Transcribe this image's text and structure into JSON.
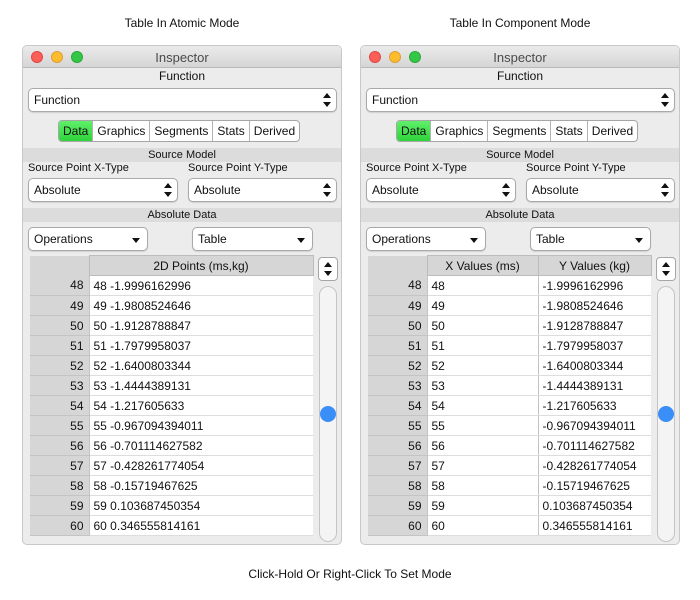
{
  "captions": {
    "left": "Table In Atomic Mode",
    "right": "Table In Component Mode",
    "bottom": "Click-Hold Or Right-Click To Set Mode"
  },
  "window": {
    "title": "Inspector",
    "function_label": "Function",
    "function_value": "Function",
    "tabs": [
      "Data",
      "Graphics",
      "Segments",
      "Stats",
      "Derived"
    ],
    "active_tab": "Data",
    "source_model_label": "Source Model",
    "x_type_label": "Source Point X-Type",
    "x_type_value": "Absolute",
    "y_type_label": "Source Point Y-Type",
    "y_type_value": "Absolute",
    "absolute_data_label": "Absolute Data",
    "operations_value": "Operations",
    "view_value": "Table",
    "scroll_level": 0.5
  },
  "atomic_table": {
    "header": "2D Points (ms,kg)",
    "rows": [
      {
        "n": "48",
        "v": "48 -1.9996162996"
      },
      {
        "n": "49",
        "v": "49 -1.9808524646"
      },
      {
        "n": "50",
        "v": "50 -1.9128788847"
      },
      {
        "n": "51",
        "v": "51 -1.7979958037"
      },
      {
        "n": "52",
        "v": "52 -1.6400803344"
      },
      {
        "n": "53",
        "v": "53 -1.4444389131"
      },
      {
        "n": "54",
        "v": "54 -1.217605633"
      },
      {
        "n": "55",
        "v": "55 -0.967094394011"
      },
      {
        "n": "56",
        "v": "56 -0.701114627582"
      },
      {
        "n": "57",
        "v": "57 -0.428261774054"
      },
      {
        "n": "58",
        "v": "58 -0.15719467625"
      },
      {
        "n": "59",
        "v": "59 0.103687450354"
      },
      {
        "n": "60",
        "v": "60 0.346555814161"
      }
    ]
  },
  "component_table": {
    "x_header": "X Values (ms)",
    "y_header": "Y Values (kg)",
    "rows": [
      {
        "n": "48",
        "x": "48",
        "y": "-1.9996162996"
      },
      {
        "n": "49",
        "x": "49",
        "y": "-1.9808524646"
      },
      {
        "n": "50",
        "x": "50",
        "y": "-1.9128788847"
      },
      {
        "n": "51",
        "x": "51",
        "y": "-1.7979958037"
      },
      {
        "n": "52",
        "x": "52",
        "y": "-1.6400803344"
      },
      {
        "n": "53",
        "x": "53",
        "y": "-1.4444389131"
      },
      {
        "n": "54",
        "x": "54",
        "y": "-1.217605633"
      },
      {
        "n": "55",
        "x": "55",
        "y": "-0.967094394011"
      },
      {
        "n": "56",
        "x": "56",
        "y": "-0.701114627582"
      },
      {
        "n": "57",
        "x": "57",
        "y": "-0.428261774054"
      },
      {
        "n": "58",
        "x": "58",
        "y": "-0.15719467625"
      },
      {
        "n": "59",
        "x": "59",
        "y": "0.103687450354"
      },
      {
        "n": "60",
        "x": "60",
        "y": "0.346555814161"
      }
    ]
  },
  "colors": {
    "active_tab": "#3fdc49",
    "slider_knob": "#3a8ef7"
  }
}
